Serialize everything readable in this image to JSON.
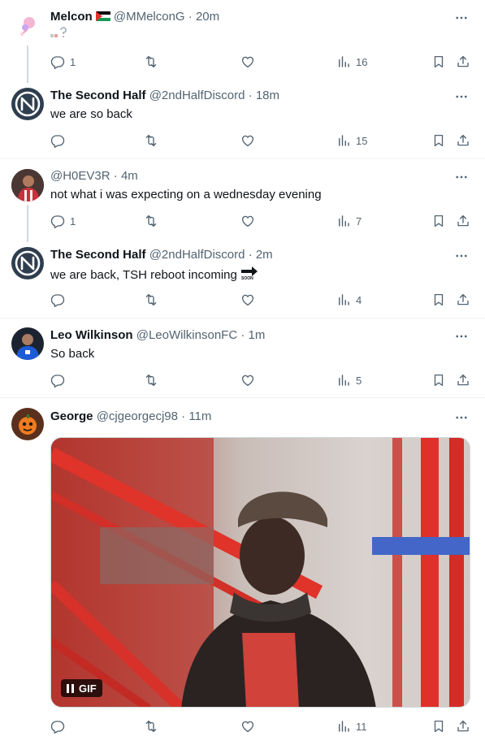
{
  "tweets": [
    {
      "name": "Melcon",
      "handle": "@MMelconG",
      "time": "20m",
      "text": "",
      "stats": {
        "replies": "1",
        "retweets": "",
        "likes": "",
        "views": "16"
      }
    },
    {
      "name": "The Second Half",
      "handle": "@2ndHalfDiscord",
      "time": "18m",
      "text": "we are so back",
      "stats": {
        "replies": "",
        "retweets": "",
        "likes": "",
        "views": "15"
      }
    },
    {
      "name": "",
      "handle": "@H0EV3R",
      "time": "4m",
      "text": "not what i was expecting on a wednesday evening",
      "stats": {
        "replies": "1",
        "retweets": "",
        "likes": "",
        "views": "7"
      }
    },
    {
      "name": "The Second Half",
      "handle": "@2ndHalfDiscord",
      "time": "2m",
      "text": "we are back, TSH reboot incoming",
      "emoji_label": "SOON",
      "stats": {
        "replies": "",
        "retweets": "",
        "likes": "",
        "views": "4"
      }
    },
    {
      "name": "Leo Wilkinson",
      "handle": "@LeoWilkinsonFC",
      "time": "1m",
      "text": "So back",
      "stats": {
        "replies": "",
        "retweets": "",
        "likes": "",
        "views": "5"
      }
    },
    {
      "name": "George",
      "handle": "@cjgeorgecj98",
      "time": "11m",
      "text": "",
      "media_badge": "GIF",
      "stats": {
        "replies": "",
        "retweets": "",
        "likes": "",
        "views": "11"
      }
    }
  ],
  "separator": "·",
  "colors": {
    "text": "#0f1419",
    "secondary": "#536471",
    "divider": "#eff3f4",
    "thread_line": "#cfd9de"
  },
  "icons": [
    "reply-icon",
    "retweet-icon",
    "like-icon",
    "views-icon",
    "bookmark-icon",
    "share-icon",
    "more-icon"
  ]
}
